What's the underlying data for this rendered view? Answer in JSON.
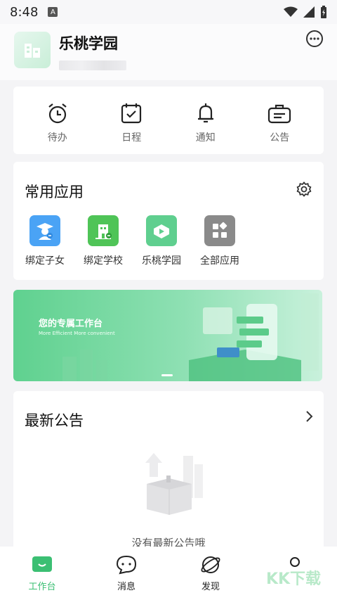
{
  "status_bar": {
    "time": "8:48",
    "notice_letter": "A"
  },
  "header": {
    "school_name": "乐桃学园"
  },
  "quick_actions": [
    {
      "label": "待办",
      "icon": "alarm-clock-icon"
    },
    {
      "label": "日程",
      "icon": "calendar-check-icon"
    },
    {
      "label": "通知",
      "icon": "bell-icon"
    },
    {
      "label": "公告",
      "icon": "briefcase-icon"
    }
  ],
  "apps": {
    "title": "常用应用",
    "items": [
      {
        "label": "绑定子女",
        "icon": "student-icon",
        "color": "#4aa3f5"
      },
      {
        "label": "绑定学校",
        "icon": "school-icon",
        "color": "#4fc457"
      },
      {
        "label": "乐桃学园",
        "icon": "play-book-icon",
        "color": "#5fcf8f"
      },
      {
        "label": "全部应用",
        "icon": "grid-icon",
        "color": "#8a8a8a"
      }
    ]
  },
  "banner": {
    "title": "您的专属工作台",
    "subtitle": "More Efficient   More convenient"
  },
  "notices": {
    "title": "最新公告",
    "empty_text": "没有最新公告哦"
  },
  "bottom_nav": [
    {
      "label": "工作台",
      "icon": "workbench-icon",
      "active": true
    },
    {
      "label": "消息",
      "icon": "chat-icon",
      "active": false
    },
    {
      "label": "发现",
      "icon": "planet-icon",
      "active": false
    }
  ],
  "colors": {
    "accent": "#3bbf73"
  }
}
